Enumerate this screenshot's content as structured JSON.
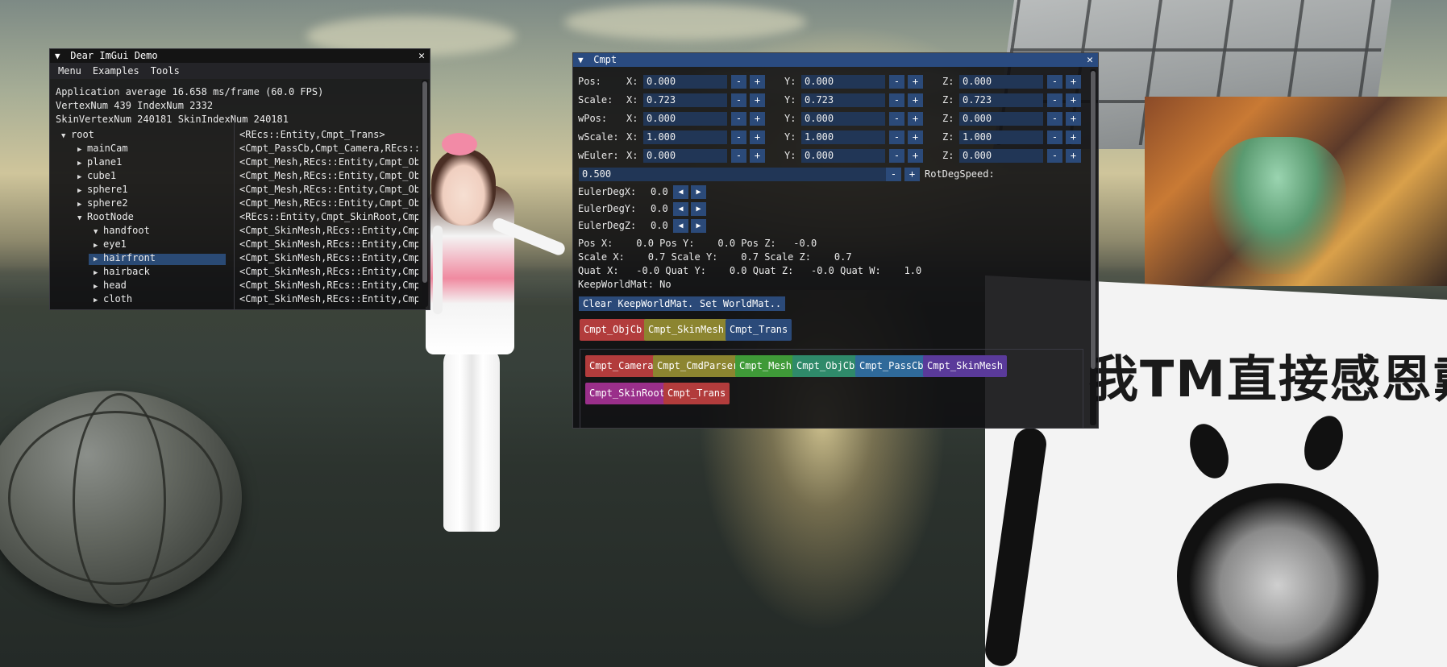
{
  "demo_window": {
    "title": "Dear ImGui Demo",
    "menus": [
      "Menu",
      "Examples",
      "Tools"
    ],
    "info": [
      "Application average 16.658 ms/frame (60.0 FPS)",
      "VertexNum 439 IndexNum 2332",
      "SkinVertexNum 240181 SkinIndexNum 240181"
    ],
    "tree": [
      {
        "label": "root",
        "arrow": "▼",
        "components": "<REcs::Entity,Cmpt_Trans>"
      },
      {
        "label": "mainCam",
        "arrow": "▶",
        "components": "<Cmpt_PassCb,Cmpt_Camera,REcs::Ent"
      },
      {
        "label": "plane1",
        "arrow": "▶",
        "components": "<Cmpt_Mesh,REcs::Entity,Cmpt_ObjCb"
      },
      {
        "label": "cube1",
        "arrow": "▶",
        "components": "<Cmpt_Mesh,REcs::Entity,Cmpt_ObjCb"
      },
      {
        "label": "sphere1",
        "arrow": "▶",
        "components": "<Cmpt_Mesh,REcs::Entity,Cmpt_ObjCb"
      },
      {
        "label": "sphere2",
        "arrow": "▶",
        "components": "<Cmpt_Mesh,REcs::Entity,Cmpt_ObjCb"
      },
      {
        "label": "RootNode",
        "arrow": "▼",
        "components": "<REcs::Entity,Cmpt_SkinRoot,Cmpt_T"
      },
      {
        "label": "handfoot",
        "arrow": "▼",
        "components": "<Cmpt_SkinMesh,REcs::Entity,Cmpt_O"
      },
      {
        "label": "eye1",
        "arrow": "▶",
        "components": "<Cmpt_SkinMesh,REcs::Entity,Cmpt_O"
      },
      {
        "label": "hairfront",
        "arrow": "▶",
        "components": "<Cmpt_SkinMesh,REcs::Entity,Cmpt_O",
        "selected": true
      },
      {
        "label": "hairback",
        "arrow": "▶",
        "components": "<Cmpt_SkinMesh,REcs::Entity,Cmpt_O"
      },
      {
        "label": "head",
        "arrow": "▶",
        "components": "<Cmpt_SkinMesh,REcs::Entity,Cmpt_O"
      },
      {
        "label": "cloth",
        "arrow": "▶",
        "components": "<Cmpt_SkinMesh,REcs::Entity,Cmpt_O"
      }
    ],
    "close_glyph": "✕",
    "title_arrow": "▼"
  },
  "cmpt_window": {
    "title": "Cmpt",
    "close_glyph": "✕",
    "title_arrow": "▼",
    "rows": [
      {
        "label": "Pos:",
        "x": "0.000",
        "y": "0.000",
        "z": "0.000"
      },
      {
        "label": "Scale:",
        "x": "0.723",
        "y": "0.723",
        "z": "0.723"
      },
      {
        "label": "wPos:",
        "x": "0.000",
        "y": "0.000",
        "z": "0.000"
      },
      {
        "label": "wScale:",
        "x": "1.000",
        "y": "1.000",
        "z": "1.000"
      },
      {
        "label": "wEuler:",
        "x": "0.000",
        "y": "0.000",
        "z": "0.000"
      }
    ],
    "axis_labels": {
      "x": "X:",
      "y": "Y:",
      "z": "Z:"
    },
    "minus": "-",
    "plus": "+",
    "rot_speed": {
      "value": "0.500",
      "label": "RotDegSpeed:"
    },
    "euler": [
      {
        "label": "EulerDegX:",
        "value": "0.0"
      },
      {
        "label": "EulerDegY:",
        "value": "0.0"
      },
      {
        "label": "EulerDegZ:",
        "value": "0.0"
      }
    ],
    "left_arrow": "◀",
    "right_arrow": "▶",
    "readout": [
      "Pos X:    0.0 Pos Y:    0.0 Pos Z:   -0.0",
      "Scale X:    0.7 Scale Y:    0.7 Scale Z:    0.7",
      "Quat X:   -0.0 Quat Y:    0.0 Quat Z:   -0.0 Quat W:    1.0"
    ],
    "keep_world_mat": "KeepWorldMat: No",
    "buttons": [
      "Clear KeepWorldMat..",
      "Set WorldMat.."
    ],
    "attached": [
      {
        "label": "Cmpt_ObjCb",
        "color": "#b23c3c"
      },
      {
        "label": "Cmpt_SkinMesh",
        "color": "#8c8530"
      },
      {
        "label": "Cmpt_Trans",
        "color": "#2b4a79"
      }
    ],
    "all_components": [
      {
        "label": "Cmpt_Camera",
        "color": "#b23c3c"
      },
      {
        "label": "Cmpt_CmdParser",
        "color": "#8c8530"
      },
      {
        "label": "Cmpt_Mesh",
        "color": "#3f9a38"
      },
      {
        "label": "Cmpt_ObjCb",
        "color": "#2f8a6a"
      },
      {
        "label": "Cmpt_PassCb",
        "color": "#2f6a9a"
      },
      {
        "label": "Cmpt_SkinMesh",
        "color": "#5a3a9a"
      },
      {
        "label": "Cmpt_SkinRoot",
        "color": "#9a2f8a"
      },
      {
        "label": "Cmpt_Trans",
        "color": "#b23c3c"
      }
    ]
  },
  "scene": {
    "meme_text": "我TM直接感恩戴德"
  }
}
